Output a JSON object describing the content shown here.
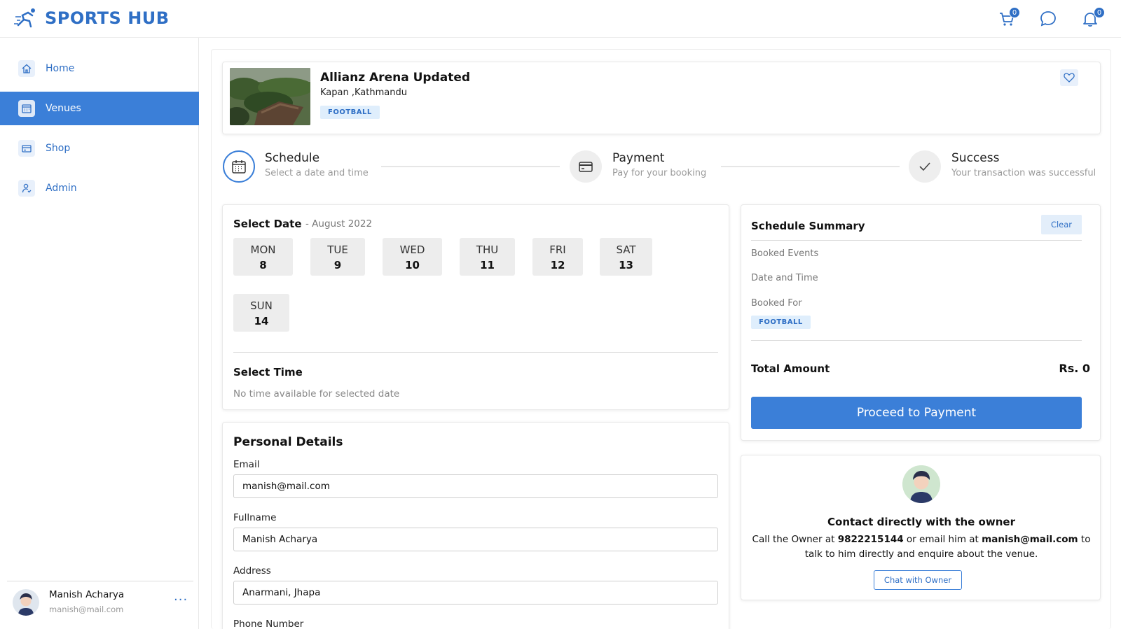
{
  "app": {
    "name": "SPORTS HUB"
  },
  "header": {
    "cart_count": "0",
    "notification_count": "0"
  },
  "sidebar": {
    "items": [
      {
        "label": "Home",
        "icon": "home-icon",
        "active": false
      },
      {
        "label": "Venues",
        "icon": "calendar-icon",
        "active": true
      },
      {
        "label": "Shop",
        "icon": "card-icon",
        "active": false
      },
      {
        "label": "Admin",
        "icon": "admin-icon",
        "active": false
      }
    ],
    "user": {
      "name": "Manish Acharya",
      "email": "manish@mail.com",
      "more": "..."
    }
  },
  "venue": {
    "name": "Allianz Arena Updated",
    "location": "Kapan ,Kathmandu",
    "sport": "FOOTBALL"
  },
  "steps": [
    {
      "title": "Schedule",
      "subtitle": "Select a date and time"
    },
    {
      "title": "Payment",
      "subtitle": "Pay for your booking"
    },
    {
      "title": "Success",
      "subtitle": "Your transaction was successful"
    }
  ],
  "date_section": {
    "title": "Select Date",
    "month": "- August 2022",
    "dates": [
      {
        "day": "MON",
        "num": "8"
      },
      {
        "day": "TUE",
        "num": "9"
      },
      {
        "day": "WED",
        "num": "10"
      },
      {
        "day": "THU",
        "num": "11"
      },
      {
        "day": "FRI",
        "num": "12"
      },
      {
        "day": "SAT",
        "num": "13"
      },
      {
        "day": "SUN",
        "num": "14"
      }
    ],
    "time_title": "Select Time",
    "time_empty": "No time available for selected date"
  },
  "personal": {
    "title": "Personal Details",
    "email_label": "Email",
    "email_value": "manish@mail.com",
    "fullname_label": "Fullname",
    "fullname_value": "Manish Acharya",
    "address_label": "Address",
    "address_value": "Anarmani, Jhapa",
    "phone_label": "Phone Number"
  },
  "summary": {
    "title": "Schedule Summary",
    "clear": "Clear",
    "booked_events": "Booked Events",
    "date_time": "Date and Time",
    "booked_for": "Booked For",
    "sport": "FOOTBALL",
    "total_label": "Total Amount",
    "total_value": "Rs. 0",
    "proceed": "Proceed to Payment"
  },
  "contact": {
    "title": "Contact directly with the owner",
    "text_1": "Call the Owner at ",
    "phone": "9822215144",
    "text_2": " or email him at ",
    "email": "manish@mail.com",
    "text_3": " to",
    "text_4": "talk to him directly and enquire about the venue.",
    "chat": "Chat with Owner"
  },
  "colors": {
    "accent": "#3b7fd8",
    "brand": "#2f6fc5",
    "tag_bg": "#dfeefc"
  }
}
